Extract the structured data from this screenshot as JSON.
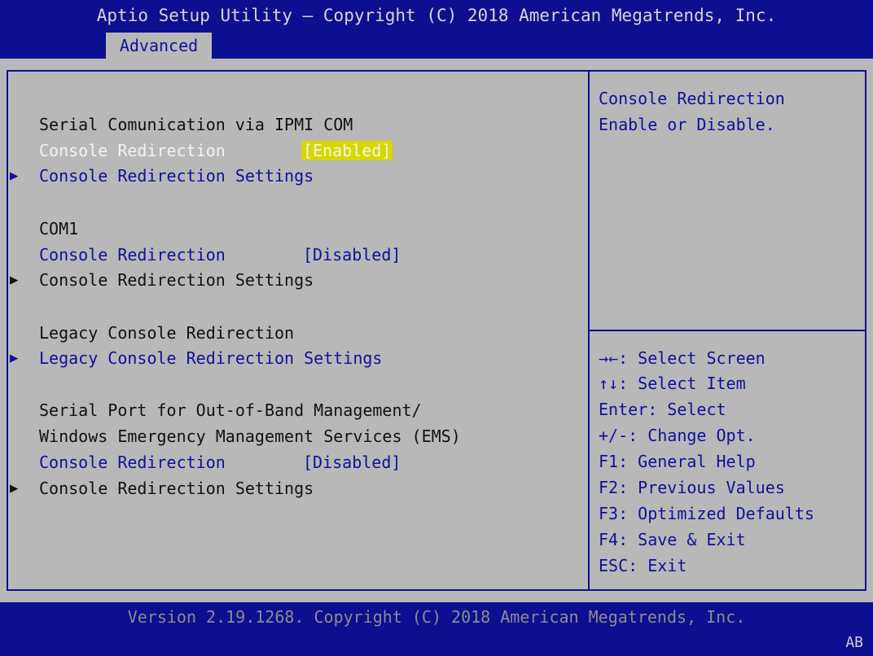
{
  "header": {
    "title": "Aptio Setup Utility – Copyright (C) 2018 American Megatrends, Inc.",
    "active_tab": "Advanced"
  },
  "main": {
    "sections": [
      {
        "heading": "Serial Comunication via IPMI COM",
        "redirection_label": "Console Redirection",
        "redirection_value": "[Enabled]",
        "settings_label": "Console Redirection Settings"
      },
      {
        "heading": "COM1",
        "redirection_label": "Console Redirection",
        "redirection_value": "[Disabled]",
        "settings_label": "Console Redirection Settings"
      },
      {
        "heading": "Legacy Console Redirection",
        "settings_label": "Legacy Console Redirection Settings"
      },
      {
        "heading_line1": "Serial Port for Out-of-Band Management/",
        "heading_line2": "Windows Emergency Management Services (EMS)",
        "redirection_label": "Console Redirection",
        "redirection_value": "[Disabled]",
        "settings_label": "Console Redirection Settings"
      }
    ]
  },
  "help": {
    "line1": "Console Redirection",
    "line2": "Enable or Disable."
  },
  "keys": [
    "→←: Select Screen",
    "↑↓: Select Item",
    "Enter: Select",
    "+/-: Change Opt.",
    "F1: General Help",
    "F2: Previous Values",
    "F3: Optimized Defaults",
    "F4: Save & Exit",
    "ESC: Exit"
  ],
  "footer": {
    "version": "Version 2.19.1268. Copyright (C) 2018 American Megatrends, Inc.",
    "code": "AB"
  },
  "colors": {
    "frame_blue": "#0c0f90",
    "panel_gray": "#b8b8b8",
    "highlight_yellow": "#d8d800"
  }
}
